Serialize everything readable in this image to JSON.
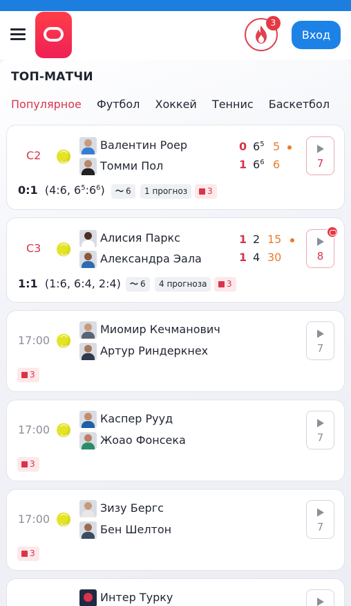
{
  "header": {
    "menu_icon": "hamburger-menu-icon",
    "logo_icon": "app-logo-icon",
    "fire_icon": "fire-icon",
    "notification_count": "3",
    "login_label": "Вход"
  },
  "section": {
    "title": "ТОП-МАТЧИ"
  },
  "tabs": [
    {
      "label": "Популярное",
      "active": true
    },
    {
      "label": "Футбол"
    },
    {
      "label": "Хоккей"
    },
    {
      "label": "Теннис"
    },
    {
      "label": "Баскетбол"
    }
  ],
  "colors": {
    "accent": "#d8344a",
    "primary_blue": "#1d82e6",
    "serve_orange": "#ea7a2c"
  },
  "matches": [
    {
      "status": "С2",
      "players": [
        "Валентин Роер",
        "Томми Пол"
      ],
      "sets": [
        "0",
        "1"
      ],
      "games_base": [
        "6",
        "6"
      ],
      "games_tiebreak": [
        "5",
        "6"
      ],
      "points": [
        "5",
        "6"
      ],
      "serving": "player1",
      "stream_count": "7",
      "total_score": "0:1",
      "set_history_prefix": "(4:6, 6",
      "set_history_sup1": "5",
      "set_history_mid": ":6",
      "set_history_sup2": "6",
      "set_history_suffix": ")",
      "trend_count": "6",
      "prognoz": "1 прогноз",
      "gift_count": "3"
    },
    {
      "status": "С3",
      "players": [
        "Алисия Паркс",
        "Александра Эала"
      ],
      "sets": [
        "1",
        "1"
      ],
      "games": [
        "2",
        "4"
      ],
      "points": [
        "15",
        "30"
      ],
      "serving": "player1",
      "stream_count": "8",
      "total_score": "1:1",
      "set_history": "(1:6, 6:4, 2:4)",
      "trend_count": "6",
      "prognoz": "4 прогноза",
      "gift_count": "3"
    },
    {
      "time": "17:00",
      "players": [
        "Миомир Кечманович",
        "Артур Риндеркнех"
      ],
      "stream_count": "7",
      "gift_count": "3"
    },
    {
      "time": "17:00",
      "players": [
        "Каспер Рууд",
        "Жоао Фонсека"
      ],
      "stream_count": "7",
      "gift_count": "3"
    },
    {
      "time": "17:00",
      "players": [
        "Зизу Бергс",
        "Бен Шелтон"
      ],
      "stream_count": "7",
      "gift_count": "3"
    },
    {
      "players": [
        "Интер Турку"
      ]
    }
  ]
}
